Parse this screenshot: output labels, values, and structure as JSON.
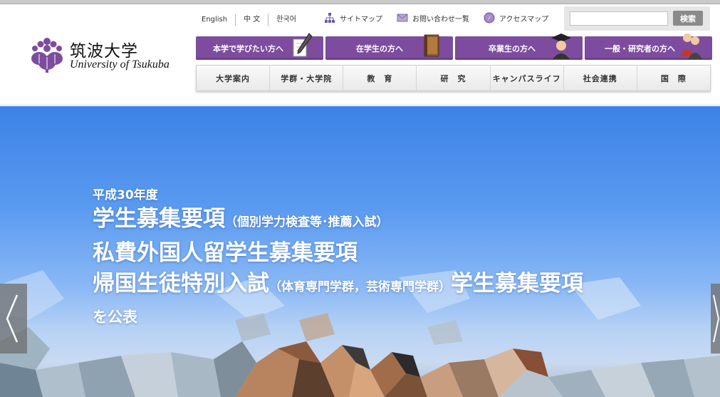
{
  "header": {
    "logo_jp": "筑波大学",
    "logo_en": "University of Tsukuba",
    "brand_color": "#7d4c9e",
    "langs": [
      "English",
      "中 文",
      "한국어"
    ],
    "utils": [
      {
        "label": "サイトマップ",
        "icon": "sitemap-icon"
      },
      {
        "label": "お問い合わせ一覧",
        "icon": "mail-icon"
      },
      {
        "label": "アクセスマップ",
        "icon": "compass-icon"
      }
    ],
    "search": {
      "placeholder": "",
      "button": "検索"
    }
  },
  "audience": [
    {
      "label": "本学で学びたい方へ",
      "icon": "pen-icon"
    },
    {
      "label": "在学生の方へ",
      "icon": "book-icon"
    },
    {
      "label": "卒業生の方へ",
      "icon": "graduate-icon"
    },
    {
      "label": "一般・研究者の方へ",
      "icon": "people-icon"
    }
  ],
  "nav": [
    "大学案内",
    "学群・大学院",
    "教　育",
    "研　究",
    "キャンパスライフ",
    "社会連携",
    "国　際"
  ],
  "hero": {
    "year": "平成30年度",
    "line1_main": "学生募集要項",
    "line1_small": "（個別学力検査等･推薦入試）",
    "line2": "私費外国人留学生募集要項",
    "line3_main": "帰国生徒特別入試",
    "line3_small": "（体育専門学群，芸術専門学群）",
    "line3_tail": "学生募集要項",
    "line4": "を公表"
  }
}
